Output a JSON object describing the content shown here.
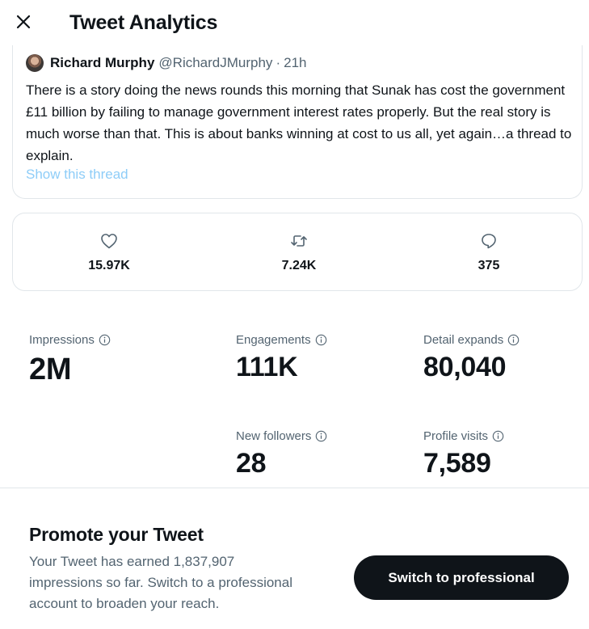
{
  "header": {
    "title": "Tweet Analytics",
    "close_icon": "close-icon"
  },
  "tweet": {
    "author_name": "Richard Murphy",
    "author_handle": "@RichardJMurphy",
    "separator": "·",
    "time": "21h",
    "text": "There is a story doing the news rounds this morning that Sunak has cost the government £11 billion by failing to manage government interest rates properly. But the real story is much worse than that. This is about banks winning at cost to us all, yet again…a thread to explain.",
    "show_thread_label": "Show this thread"
  },
  "metrics": {
    "likes": {
      "icon": "heart-icon",
      "value": "15.97K"
    },
    "retweets": {
      "icon": "retweet-icon",
      "value": "7.24K"
    },
    "replies": {
      "icon": "reply-icon",
      "value": "375"
    }
  },
  "stats": {
    "impressions": {
      "label": "Impressions",
      "value": "2M"
    },
    "engagements": {
      "label": "Engagements",
      "value": "111K"
    },
    "detail_expands": {
      "label": "Detail expands",
      "value": "80,040"
    },
    "new_followers": {
      "label": "New followers",
      "value": "28"
    },
    "profile_visits": {
      "label": "Profile visits",
      "value": "7,589"
    }
  },
  "promote": {
    "title": "Promote your Tweet",
    "text": "Your Tweet has earned 1,837,907 impressions so far. Switch to a professional account to broaden your reach.",
    "button_label": "Switch to professional"
  },
  "colors": {
    "text_primary": "#0f1419",
    "text_secondary": "#536471",
    "link_light": "#8ecdf8",
    "border": "#e1e6ea",
    "button_bg": "#0f1419"
  }
}
